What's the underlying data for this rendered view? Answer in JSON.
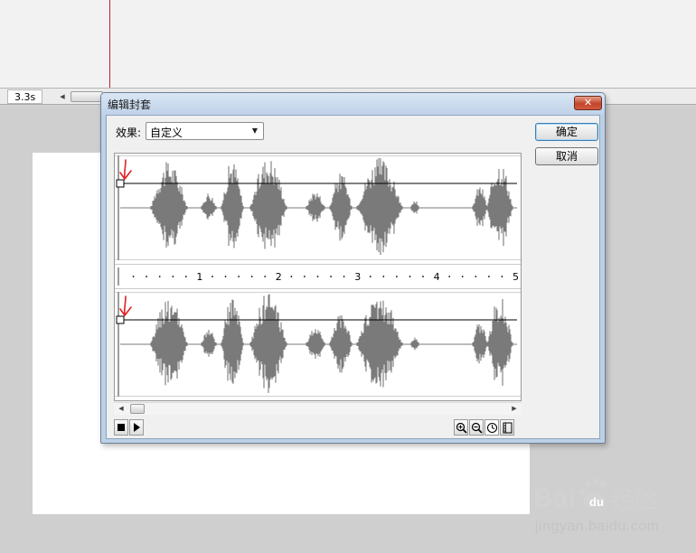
{
  "background_app": {
    "time_readout": "3.3s"
  },
  "dialog": {
    "title": "编辑封套",
    "close_glyph": "✕",
    "effect_label": "效果:",
    "effect_value": "自定义",
    "ok_label": "确定",
    "cancel_label": "取消",
    "ruler": {
      "unit_labels": [
        "1",
        "2",
        "3",
        "4",
        "5"
      ],
      "ticks_per_unit": 6
    },
    "envelope_level": 0.73,
    "tools": {
      "stop_icon": "stop-icon",
      "play_icon": "play-icon",
      "zoom_in_icon": "zoom-in-icon",
      "zoom_out_icon": "zoom-out-icon",
      "seconds_icon": "clock-icon",
      "frames_icon": "frames-icon",
      "time_unit_selected": "seconds"
    }
  },
  "annotations": {
    "arrow_color": "#e02020"
  },
  "watermark": {
    "logo_text": "Bai",
    "logo_text_suffix": "du",
    "logo_product": "经验",
    "url": "jingyan.baidu.com"
  },
  "colors": {
    "waveform": "#7a7a7a",
    "playhead": "#c0202a",
    "title_bar": "#bfd2e8"
  }
}
